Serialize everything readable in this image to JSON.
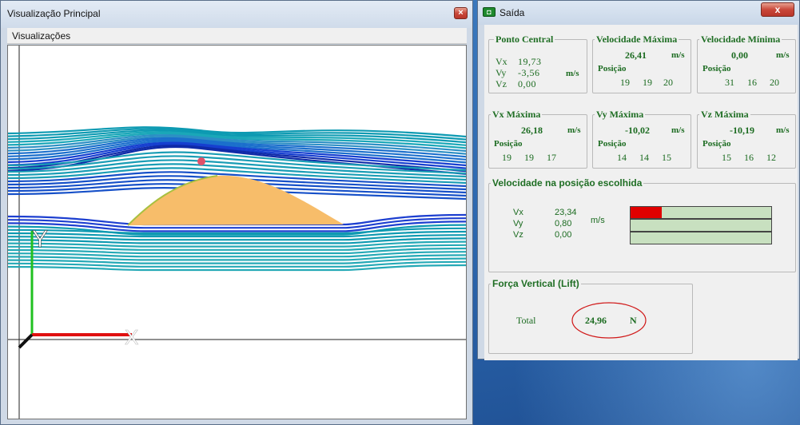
{
  "left_window": {
    "title": "Visualização Principal",
    "close_glyph": "×",
    "menu": {
      "items": [
        "Visualizações"
      ]
    },
    "viewport": {
      "axis_y_label": "Y",
      "axis_x_label": "X",
      "colors": {
        "body": "#f7bd6a",
        "axis_y": "#20c020",
        "axis_x": "#e01010",
        "marker": "#e0506a"
      }
    }
  },
  "right_window": {
    "title": "Saída",
    "close_glyph": "x",
    "icon": "app-icon",
    "ponto_central": {
      "legend": "Ponto Central",
      "rows": [
        {
          "label": "Vx",
          "value": "19,73"
        },
        {
          "label": "Vy",
          "value": "-3,56",
          "unit": "m/s"
        },
        {
          "label": "Vz",
          "value": "0,00"
        }
      ]
    },
    "velocidade_maxima": {
      "legend": "Velocidade Máxima",
      "value": "26,41",
      "unit": "m/s",
      "pos_label": "Posição",
      "pos": [
        "19",
        "19",
        "20"
      ]
    },
    "velocidade_minima": {
      "legend": "Velocidade Mínima",
      "value": "0,00",
      "unit": "m/s",
      "pos_label": "Posição",
      "pos": [
        "31",
        "16",
        "20"
      ]
    },
    "vx_maxima": {
      "legend": "Vx Máxima",
      "value": "26,18",
      "unit": "m/s",
      "pos_label": "Posição",
      "pos": [
        "19",
        "19",
        "17"
      ]
    },
    "vy_maxima": {
      "legend": "Vy Máxima",
      "value": "-10,02",
      "unit": "m/s",
      "pos_label": "Posição",
      "pos": [
        "14",
        "14",
        "15"
      ]
    },
    "vz_maxima": {
      "legend": "Vz Máxima",
      "value": "-10,19",
      "unit": "m/s",
      "pos_label": "Posição",
      "pos": [
        "15",
        "16",
        "12"
      ]
    },
    "velocidade_posicao": {
      "legend": "Velocidade na posição escolhida",
      "rows": [
        {
          "label": "Vx",
          "value": "23,34",
          "bar_fraction": 0.22
        },
        {
          "label": "Vy",
          "value": "0,80",
          "bar_fraction": 0
        },
        {
          "label": "Vz",
          "value": "0,00",
          "bar_fraction": 0
        }
      ],
      "unit": "m/s",
      "bar_fill_color": "#e00000",
      "bar_bg_color": "#c8e0c0"
    },
    "forca_vertical": {
      "legend": "Força Vertical (Lift)",
      "label": "Total",
      "value": "24,96",
      "unit": "N",
      "highlight_color": "#d01818"
    }
  }
}
